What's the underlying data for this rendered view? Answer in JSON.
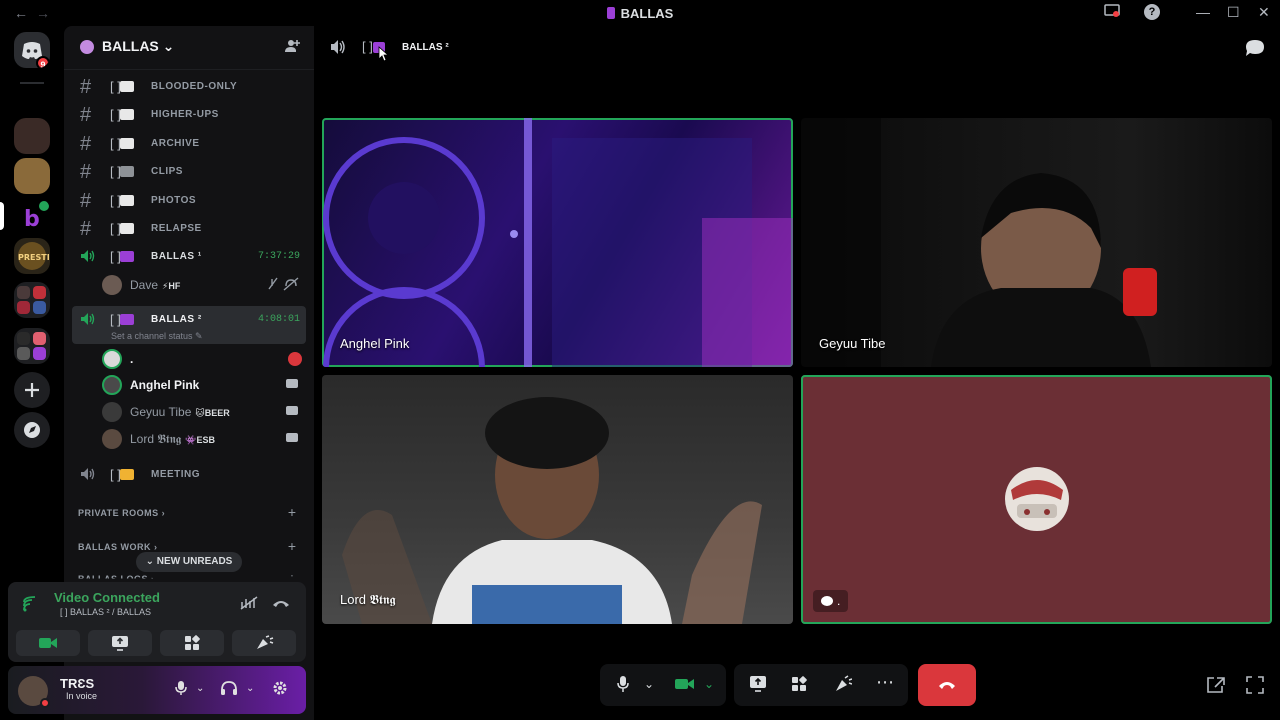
{
  "window": {
    "title": "BALLAS",
    "back_icon": "←",
    "forward_icon": "→",
    "minimize": "—",
    "maximize": "☐",
    "close": "✕",
    "help": "?"
  },
  "rail": {
    "home_badge": "9"
  },
  "guild": {
    "name": "BALLAS ⌄"
  },
  "channels": [
    {
      "name": "BLOODED-ONLY",
      "bracket": "[ ]"
    },
    {
      "name": "HIGHER-UPS",
      "bracket": "[ ]"
    },
    {
      "name": "ARCHIVE",
      "bracket": "[ ]"
    },
    {
      "name": "CLIPS",
      "bracket": "[ ]"
    },
    {
      "name": "PHOTOS",
      "bracket": "[ ]"
    },
    {
      "name": "RELAPSE",
      "bracket": "[ ]"
    }
  ],
  "voice_channels": {
    "ballas1": {
      "name": "BALLAS ¹",
      "time": "7:37:29",
      "bracket": "[ ]"
    },
    "ballas1_user": {
      "name": "Dave",
      "tag": "⚡HF"
    },
    "ballas2": {
      "name": "BALLAS ²",
      "time": "4:08:01",
      "status": "Set a channel status ✎",
      "bracket": "[ ]"
    },
    "ballas2_users": [
      {
        "name": ".",
        "tag": ""
      },
      {
        "name": "Anghel Pink",
        "tag": ""
      },
      {
        "name": "Geyuu Tibe",
        "tag": "🐱BEER"
      },
      {
        "name": "Lord 𝕭𝖙𝖓𝖌",
        "tag": "👾ESB"
      }
    ],
    "meeting": {
      "name": "MEETING",
      "bracket": "[ ]"
    }
  },
  "categories": [
    {
      "name": "PRIVATE ROOMS ›"
    },
    {
      "name": "BALLAS WORK ›"
    },
    {
      "name": "BALLAS LOGS ›"
    }
  ],
  "new_unreads": "⌄ NEW UNREADS",
  "voice_panel": {
    "title": "Video Connected",
    "subtitle": "[ ] BALLAS ² / BALLAS"
  },
  "user_panel": {
    "name": "TRƐS",
    "status": "In voice"
  },
  "main": {
    "channel_name": "BALLAS ²",
    "bracket": "[ ]"
  },
  "tiles": [
    {
      "name": "Anghel Pink"
    },
    {
      "name": "Geyuu Tibe"
    },
    {
      "name": "Lord 𝕭𝖙𝖓𝖌"
    },
    {
      "name": "."
    }
  ],
  "colors": {
    "accent_green": "#23a559",
    "hangup_red": "#da373c",
    "tile4_bg": "#6b2f35"
  }
}
